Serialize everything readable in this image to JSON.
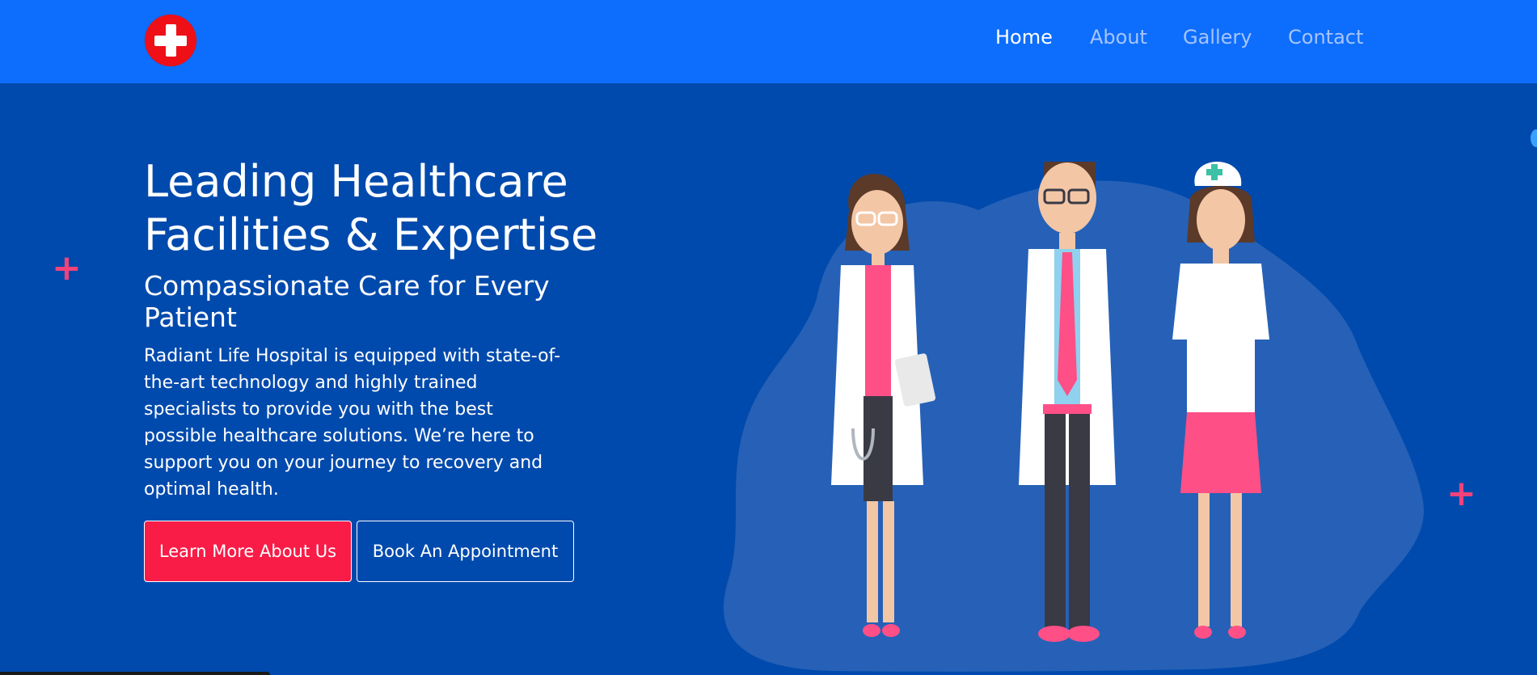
{
  "nav": {
    "home": "Home",
    "about": "About",
    "gallery": "Gallery",
    "contact": "Contact"
  },
  "hero": {
    "title_line1": "Leading Healthcare",
    "title_line2": "Facilities & Expertise",
    "subtitle": "Compassionate Care for Every Patient",
    "body": "Radiant Life Hospital is equipped with state-of-the-art technology and highly trained specialists to provide you with the best possible healthcare solutions. We’re here to support you on your journey to recovery and optimal health.",
    "btn_learn": "Learn More About Us",
    "btn_book": "Book An Appointment"
  },
  "icons": {
    "logo": "medical-cross-icon",
    "decorations": [
      "plus-icon",
      "plus-icon"
    ]
  },
  "colors": {
    "header": "#0d6efd",
    "hero": "#004aad",
    "accent": "#f81c47",
    "logo": "#ee0f17"
  }
}
